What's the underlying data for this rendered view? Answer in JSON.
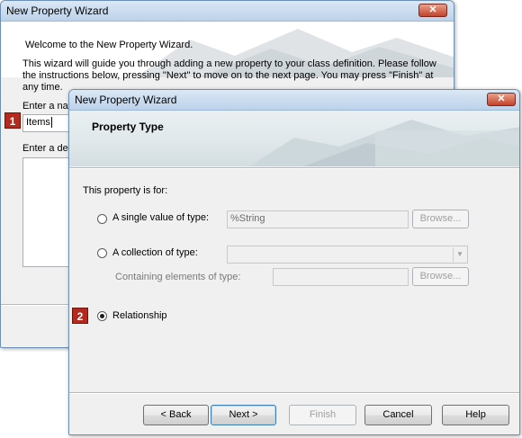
{
  "back_window": {
    "title": "New Property Wizard",
    "close_glyph": "✕",
    "welcome": "Welcome to the New Property Wizard.",
    "intro_lines": [
      "This wizard will guide you through adding a new property to your class definition. Please follow",
      "the instructions below, pressing \"Next\" to move on to the next page. You may press \"Finish\" at",
      "any time."
    ],
    "name_label": "Enter a nar",
    "name_value": "Items",
    "desc_label": "Enter a des"
  },
  "markers": {
    "one": "1",
    "two": "2",
    "color": "#b52a1e"
  },
  "front_window": {
    "title": "New Property Wizard",
    "close_glyph": "✕",
    "page_title": "Property Type",
    "section_label": "This property is for:",
    "options": {
      "single": {
        "label": "A single value of type:",
        "value": "%String",
        "browse": "Browse...",
        "selected": false
      },
      "collection": {
        "label": "A collection of type:",
        "value": "",
        "contain_label": "Containing elements of type:",
        "contain_value": "",
        "browse": "Browse...",
        "selected": false
      },
      "relationship": {
        "label": "Relationship",
        "selected": true
      }
    },
    "buttons": {
      "back": "< Back",
      "next": "Next >",
      "finish": "Finish",
      "cancel": "Cancel",
      "help": "Help"
    }
  },
  "icons": {
    "close": "close-icon",
    "dropdown": "chevron-down-icon"
  }
}
